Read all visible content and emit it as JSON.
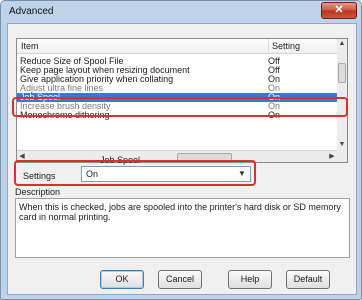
{
  "window": {
    "title": "Advanced",
    "close_glyph": "✕"
  },
  "list": {
    "headers": {
      "item": "Item",
      "setting": "Setting"
    },
    "rows": [
      {
        "name": "Reduce Size of Spool File",
        "value": "Off"
      },
      {
        "name": "Keep page layout when resizing document",
        "value": "Off"
      },
      {
        "name": "Give application priority when collating",
        "value": "On"
      },
      {
        "name": "Adjust ultra fine lines",
        "value": "On"
      },
      {
        "name": "Job Spool",
        "value": "On"
      },
      {
        "name": "Increase brush density",
        "value": "On"
      },
      {
        "name": "Monochrome dithering",
        "value": "On"
      }
    ],
    "selected_row": "Job Spool",
    "scroll": {
      "up": "▲",
      "down": "▼",
      "left": "◀",
      "right": "▶"
    }
  },
  "setting_panel": {
    "name": "Job Spool",
    "label": "Settings",
    "value": "On",
    "arrow": "▼"
  },
  "description": {
    "title": "Description",
    "text": "When this is checked, jobs are spooled into the printer's hard disk or SD memory card in normal printing."
  },
  "buttons": {
    "ok": "OK",
    "cancel": "Cancel",
    "help": "Help",
    "default": "Default"
  },
  "colors": {
    "selection": "#3a78d8",
    "highlight_box": "#d7302f"
  }
}
